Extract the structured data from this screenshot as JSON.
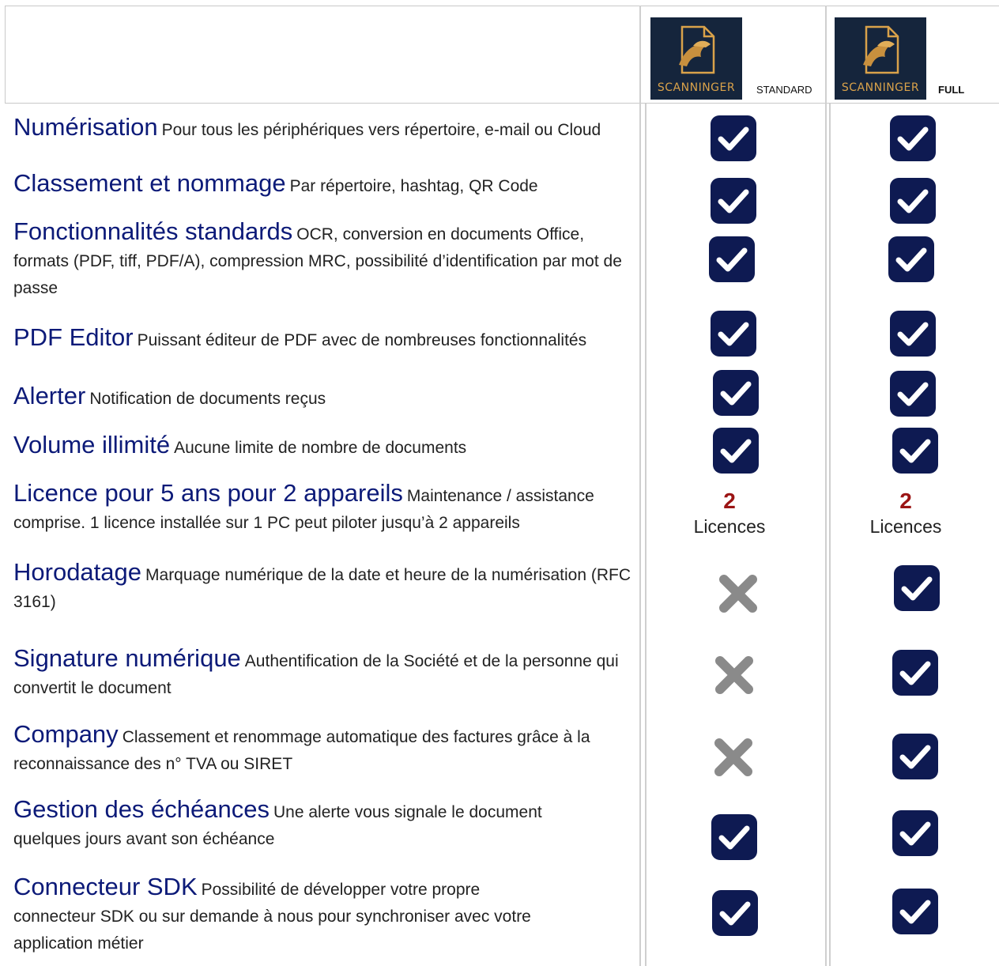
{
  "plans": [
    {
      "logo_text": "SCANNINGER",
      "label": "STANDARD"
    },
    {
      "logo_text": "SCANNINGER",
      "label": "FULL"
    }
  ],
  "features": [
    {
      "title": "Numérisation",
      "desc": "Pour tous les périphériques vers répertoire, e-mail ou Cloud",
      "standard": "check",
      "full": "check"
    },
    {
      "title": "Classement et nommage",
      "desc": "Par répertoire, hashtag, QR Code",
      "standard": "check",
      "full": "check"
    },
    {
      "title": "Fonctionnalités standards",
      "desc": "OCR, conversion en documents Office, formats (PDF, tiff, PDF/A), compression MRC, possibilité d’identification par mot de passe",
      "standard": "check",
      "full": "check"
    },
    {
      "title": "PDF Editor",
      "desc": "Puissant éditeur de PDF avec de nombreuses fonctionnalités",
      "standard": "check",
      "full": "check"
    },
    {
      "title": "Alerter",
      "desc": "Notification de documents reçus",
      "standard": "check",
      "full": "check"
    },
    {
      "title": "Volume illimité",
      "desc": "Aucune limite de nombre de documents",
      "standard": "check",
      "full": "check"
    },
    {
      "title": "Licence pour 5 ans pour 2 appareils",
      "desc": "Maintenance / assistance comprise. 1 licence installée sur 1 PC peut piloter jusqu’à 2 appareils",
      "standard": "licence",
      "full": "licence"
    },
    {
      "title": "Horodatage",
      "desc": "Marquage numérique de la date et heure de la numérisation (RFC 3161)",
      "standard": "cross",
      "full": "check"
    },
    {
      "title": "Signature numérique",
      "desc": "Authentification de la Société et de la personne qui convertit le document",
      "standard": "cross",
      "full": "check"
    },
    {
      "title": "Company",
      "desc": "Classement et renommage automatique des factures grâce à la reconnaissance des n° TVA ou SIRET",
      "standard": "cross",
      "full": "check"
    },
    {
      "title": "Gestion des échéances",
      "desc": "Une alerte vous signale le document quelques jours avant son échéance",
      "standard": "check",
      "full": "check"
    },
    {
      "title": "Connecteur SDK",
      "desc": "Possibilité de développer votre propre connecteur SDK ou sur demande à nous pour synchroniser avec votre application métier",
      "standard": "check",
      "full": "check"
    }
  ],
  "licence": {
    "count": "2",
    "label": "Licences"
  },
  "colors": {
    "title_blue": "#0c1a78",
    "check_bg": "#0e1a52",
    "cross_gray": "#8a8a8a",
    "licence_red": "#9b1414",
    "logo_bg": "#15253c",
    "logo_gold": "#d9a24a"
  },
  "icons": {
    "check": "check-icon",
    "cross": "cross-icon",
    "logo": "eagle-document-icon"
  }
}
